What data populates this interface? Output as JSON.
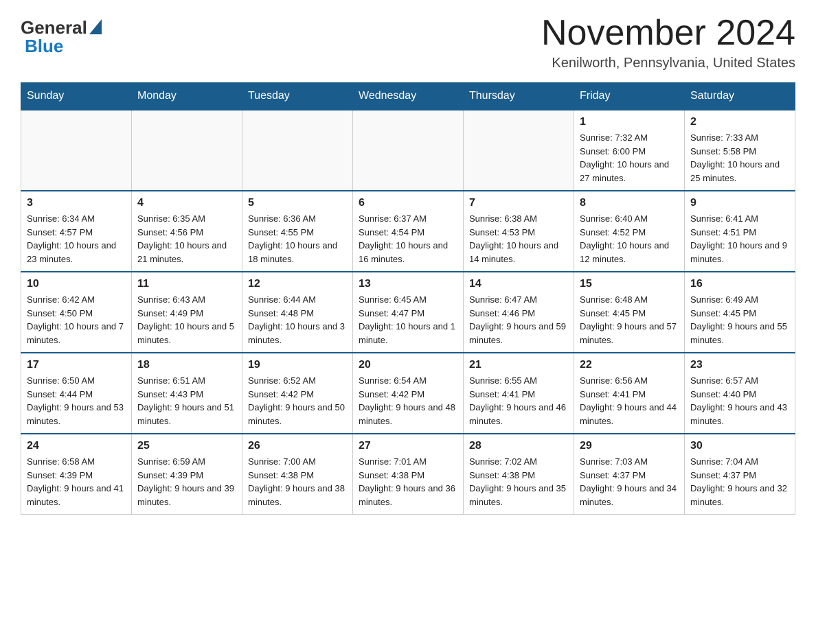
{
  "header": {
    "title": "November 2024",
    "location": "Kenilworth, Pennsylvania, United States",
    "logo": {
      "general": "General",
      "blue": "Blue"
    }
  },
  "weekdays": [
    "Sunday",
    "Monday",
    "Tuesday",
    "Wednesday",
    "Thursday",
    "Friday",
    "Saturday"
  ],
  "weeks": [
    [
      {
        "day": "",
        "info": ""
      },
      {
        "day": "",
        "info": ""
      },
      {
        "day": "",
        "info": ""
      },
      {
        "day": "",
        "info": ""
      },
      {
        "day": "",
        "info": ""
      },
      {
        "day": "1",
        "info": "Sunrise: 7:32 AM\nSunset: 6:00 PM\nDaylight: 10 hours and 27 minutes."
      },
      {
        "day": "2",
        "info": "Sunrise: 7:33 AM\nSunset: 5:58 PM\nDaylight: 10 hours and 25 minutes."
      }
    ],
    [
      {
        "day": "3",
        "info": "Sunrise: 6:34 AM\nSunset: 4:57 PM\nDaylight: 10 hours and 23 minutes."
      },
      {
        "day": "4",
        "info": "Sunrise: 6:35 AM\nSunset: 4:56 PM\nDaylight: 10 hours and 21 minutes."
      },
      {
        "day": "5",
        "info": "Sunrise: 6:36 AM\nSunset: 4:55 PM\nDaylight: 10 hours and 18 minutes."
      },
      {
        "day": "6",
        "info": "Sunrise: 6:37 AM\nSunset: 4:54 PM\nDaylight: 10 hours and 16 minutes."
      },
      {
        "day": "7",
        "info": "Sunrise: 6:38 AM\nSunset: 4:53 PM\nDaylight: 10 hours and 14 minutes."
      },
      {
        "day": "8",
        "info": "Sunrise: 6:40 AM\nSunset: 4:52 PM\nDaylight: 10 hours and 12 minutes."
      },
      {
        "day": "9",
        "info": "Sunrise: 6:41 AM\nSunset: 4:51 PM\nDaylight: 10 hours and 9 minutes."
      }
    ],
    [
      {
        "day": "10",
        "info": "Sunrise: 6:42 AM\nSunset: 4:50 PM\nDaylight: 10 hours and 7 minutes."
      },
      {
        "day": "11",
        "info": "Sunrise: 6:43 AM\nSunset: 4:49 PM\nDaylight: 10 hours and 5 minutes."
      },
      {
        "day": "12",
        "info": "Sunrise: 6:44 AM\nSunset: 4:48 PM\nDaylight: 10 hours and 3 minutes."
      },
      {
        "day": "13",
        "info": "Sunrise: 6:45 AM\nSunset: 4:47 PM\nDaylight: 10 hours and 1 minute."
      },
      {
        "day": "14",
        "info": "Sunrise: 6:47 AM\nSunset: 4:46 PM\nDaylight: 9 hours and 59 minutes."
      },
      {
        "day": "15",
        "info": "Sunrise: 6:48 AM\nSunset: 4:45 PM\nDaylight: 9 hours and 57 minutes."
      },
      {
        "day": "16",
        "info": "Sunrise: 6:49 AM\nSunset: 4:45 PM\nDaylight: 9 hours and 55 minutes."
      }
    ],
    [
      {
        "day": "17",
        "info": "Sunrise: 6:50 AM\nSunset: 4:44 PM\nDaylight: 9 hours and 53 minutes."
      },
      {
        "day": "18",
        "info": "Sunrise: 6:51 AM\nSunset: 4:43 PM\nDaylight: 9 hours and 51 minutes."
      },
      {
        "day": "19",
        "info": "Sunrise: 6:52 AM\nSunset: 4:42 PM\nDaylight: 9 hours and 50 minutes."
      },
      {
        "day": "20",
        "info": "Sunrise: 6:54 AM\nSunset: 4:42 PM\nDaylight: 9 hours and 48 minutes."
      },
      {
        "day": "21",
        "info": "Sunrise: 6:55 AM\nSunset: 4:41 PM\nDaylight: 9 hours and 46 minutes."
      },
      {
        "day": "22",
        "info": "Sunrise: 6:56 AM\nSunset: 4:41 PM\nDaylight: 9 hours and 44 minutes."
      },
      {
        "day": "23",
        "info": "Sunrise: 6:57 AM\nSunset: 4:40 PM\nDaylight: 9 hours and 43 minutes."
      }
    ],
    [
      {
        "day": "24",
        "info": "Sunrise: 6:58 AM\nSunset: 4:39 PM\nDaylight: 9 hours and 41 minutes."
      },
      {
        "day": "25",
        "info": "Sunrise: 6:59 AM\nSunset: 4:39 PM\nDaylight: 9 hours and 39 minutes."
      },
      {
        "day": "26",
        "info": "Sunrise: 7:00 AM\nSunset: 4:38 PM\nDaylight: 9 hours and 38 minutes."
      },
      {
        "day": "27",
        "info": "Sunrise: 7:01 AM\nSunset: 4:38 PM\nDaylight: 9 hours and 36 minutes."
      },
      {
        "day": "28",
        "info": "Sunrise: 7:02 AM\nSunset: 4:38 PM\nDaylight: 9 hours and 35 minutes."
      },
      {
        "day": "29",
        "info": "Sunrise: 7:03 AM\nSunset: 4:37 PM\nDaylight: 9 hours and 34 minutes."
      },
      {
        "day": "30",
        "info": "Sunrise: 7:04 AM\nSunset: 4:37 PM\nDaylight: 9 hours and 32 minutes."
      }
    ]
  ]
}
